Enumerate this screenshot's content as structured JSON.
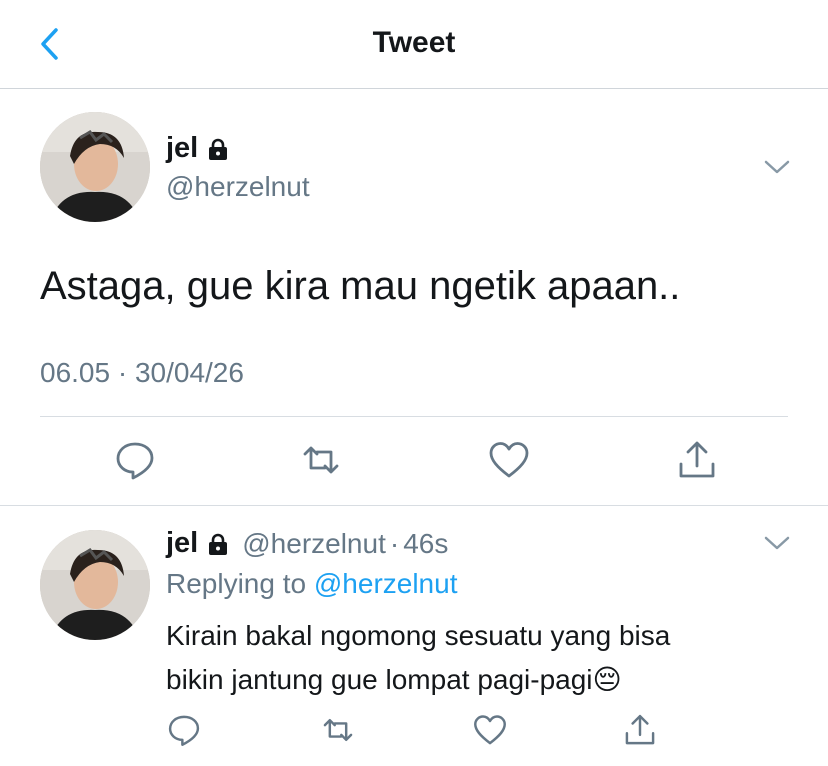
{
  "header": {
    "title": "Tweet",
    "back_icon": "chevron-left-icon"
  },
  "colors": {
    "accent": "#1da1f2",
    "secondary_text": "#657786",
    "primary_text": "#14171a"
  },
  "main_tweet": {
    "name": "jel",
    "handle": "@herzelnut",
    "text": "Astaga, gue kira mau ngetik apaan..",
    "timestamp": "06.05 · 30/04/26",
    "actions": [
      "reply-icon",
      "retweet-icon",
      "like-icon",
      "share-icon"
    ]
  },
  "reply_tweet": {
    "name": "jel",
    "handle": "@herzelnut",
    "separator": "·",
    "age": "46s",
    "replying_prefix": "Replying to",
    "replying_handle": "@herzelnut",
    "text_line1": "Kirain bakal ngomong sesuatu yang bisa",
    "text_line2": "bikin jantung gue lompat pagi-pagi",
    "emoji": "😔"
  }
}
